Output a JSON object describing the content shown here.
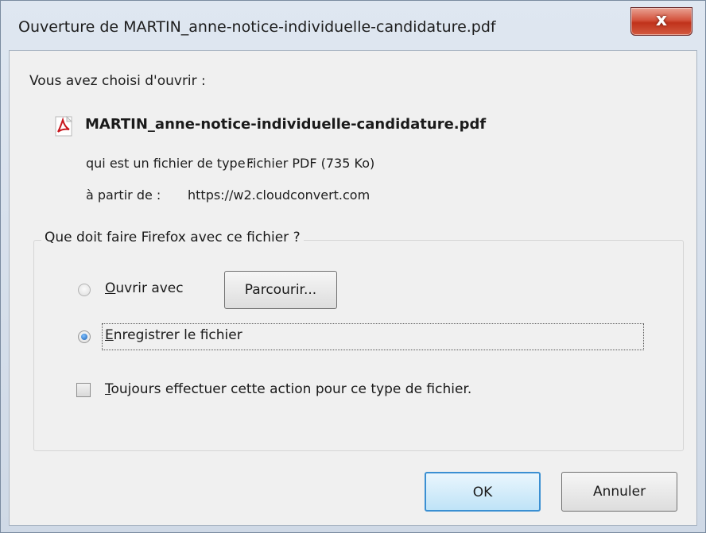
{
  "window": {
    "title": "Ouverture de MARTIN_anne-notice-individuelle-candidature.pdf",
    "close_glyph": "x"
  },
  "intro": "Vous avez choisi d'ouvrir :",
  "file": {
    "icon": "pdf-file-icon",
    "name": "MARTIN_anne-notice-individuelle-candidature.pdf",
    "type_label": "qui est un fichier de type :",
    "type_value": "Fichier PDF (735 Ko)",
    "source_label": "à partir de :",
    "source_value": "https://w2.cloudconvert.com"
  },
  "action_group": {
    "legend": "Que doit faire Firefox avec ce fichier ?",
    "open_with_label": "Ouvrir avec",
    "browse_label": "Parcourir...",
    "save_label": "Enregistrer le fichier",
    "always_label": "Toujours effectuer cette action pour ce type de fichier.",
    "open_with_selected": false,
    "save_selected": true,
    "always_checked": false
  },
  "buttons": {
    "ok": "OK",
    "cancel": "Annuler"
  }
}
